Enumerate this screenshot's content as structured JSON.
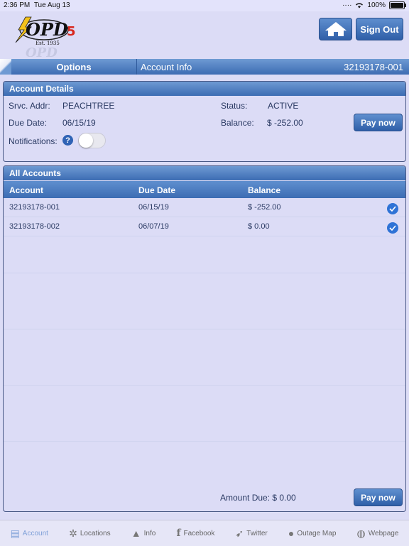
{
  "status_bar": {
    "time": "2:36 PM",
    "date": "Tue Aug 13",
    "battery": "100%"
  },
  "header": {
    "logo_text": "OPD",
    "logo_number": "5",
    "logo_est": "Est. 1935",
    "signout_label": "Sign Out"
  },
  "nav": {
    "options_label": "Options",
    "title": "Account Info",
    "account_number": "32193178-001"
  },
  "details": {
    "heading": "Account Details",
    "srvc_addr_label": "Srvc. Addr:",
    "srvc_addr": "PEACHTREE",
    "status_label": "Status:",
    "status": "ACTIVE",
    "due_date_label": "Due Date:",
    "due_date": "06/15/19",
    "balance_label": "Balance:",
    "balance": "$ -252.00",
    "notifications_label": "Notifications:",
    "help_glyph": "?",
    "pay_label": "Pay now"
  },
  "accounts": {
    "heading": "All Accounts",
    "columns": [
      "Account",
      "Due Date",
      "Balance"
    ],
    "rows": [
      {
        "account": "32193178-001",
        "due_date": "06/15/19",
        "balance": "$ -252.00"
      },
      {
        "account": "32193178-002",
        "due_date": "06/07/19",
        "balance": "$ 0.00"
      }
    ],
    "amount_due": "Amount Due: $ 0.00",
    "pay_label": "Pay now"
  },
  "tabs": [
    "Account",
    "Locations",
    "Info",
    "Facebook",
    "Twitter",
    "Outage Map",
    "Webpage"
  ],
  "colors": {
    "accent": "#3c6cb3",
    "background": "#dcdcf6"
  }
}
